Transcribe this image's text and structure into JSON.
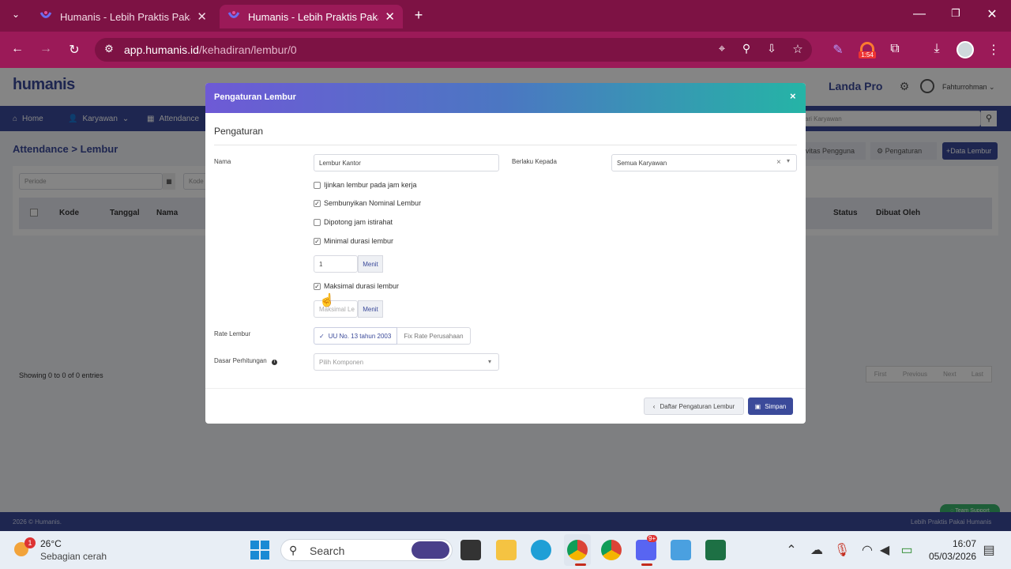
{
  "browser": {
    "tabs": [
      {
        "title": "Humanis - Lebih Praktis Pakai H"
      },
      {
        "title": "Humanis - Lebih Praktis Pakai H"
      }
    ],
    "url_host": "app.humanis.id",
    "url_path": "/kehadiran/lembur/0",
    "ext_badge": "1:54"
  },
  "app": {
    "logo": "humanis",
    "plan": "Landa Pro",
    "user": "Fahturrohman",
    "nav": {
      "home": "Home",
      "karyawan": "Karyawan",
      "attendance": "Attendance"
    },
    "breadcrumb": {
      "root": "Attendance",
      "sep": ">",
      "current": "Lembur"
    },
    "filters": {
      "periode_placeholder": "Periode",
      "kode_placeholder": "Kode",
      "search_placeholder": "ari Karyawan"
    },
    "actions": {
      "aktivitas": "ivitas Pengguna",
      "pengaturan": "Pengaturan",
      "data_lembur": "+Data Lembur"
    },
    "table": {
      "headers": [
        "Kode",
        "Tanggal",
        "Nama",
        "Status",
        "Dibuat Oleh"
      ]
    },
    "showing": "Showing 0 to 0 of 0 entries",
    "pager": [
      "First",
      "Previous",
      "Next",
      "Last"
    ],
    "footer_left": "2026 © Humanis.",
    "footer_right": "Lebih Praktis Pakai Humanis",
    "support": "Team Support"
  },
  "modal": {
    "title": "Pengaturan Lembur",
    "close": "×",
    "section": "Pengaturan",
    "nama_label": "Nama",
    "nama_value": "Lembur Kantor",
    "berlaku_label": "Berlaku Kepada",
    "berlaku_value": "Semua Karyawan",
    "checkboxes": [
      {
        "label": "Ijinkan lembur pada jam kerja",
        "checked": false
      },
      {
        "label": "Sembunyikan Nominal Lembur",
        "checked": true
      },
      {
        "label": "Dipotong jam istirahat",
        "checked": false
      },
      {
        "label": "Minimal durasi lembur",
        "checked": true
      },
      {
        "label": "Maksimal durasi lembur",
        "checked": true
      }
    ],
    "min_value": "1",
    "unit": "Menit",
    "max_placeholder": "Maksimal Le",
    "rate_label": "Rate Lembur",
    "rate_opt1": "UU No. 13 tahun 2003",
    "rate_opt2": "Fix Rate Perusahaan",
    "dasar_label": "Dasar Perhitungan",
    "dasar_placeholder": "Pilih Komponen",
    "btn_daftar": "Daftar Pengaturan Lembur",
    "btn_simpan": "Simpan"
  },
  "taskbar": {
    "temp": "26°C",
    "weather": "Sebagian cerah",
    "weather_badge": "1",
    "search": "Search",
    "time": "16:07",
    "date": "05/03/2026",
    "discord_badge": "9+"
  }
}
